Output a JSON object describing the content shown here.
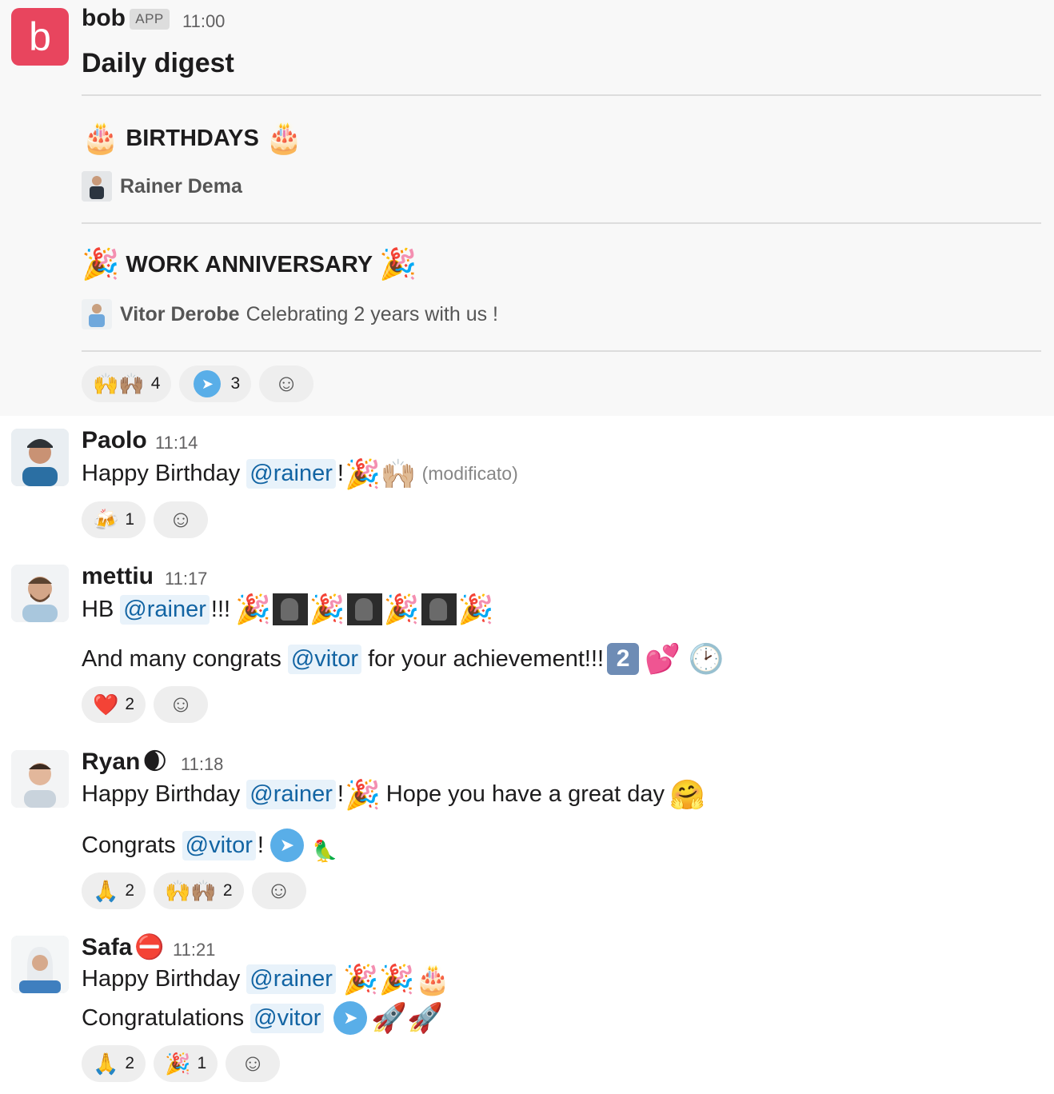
{
  "bot": {
    "name": "bob",
    "badge": "APP",
    "time": "11:00",
    "title": "Daily digest",
    "avatar_letter": "b",
    "birthdays_label": "BIRTHDAYS",
    "birthdays_emoji": "🎂",
    "birthday_person": "Rainer Dema",
    "anniversary_label": "WORK ANNIVERSARY",
    "anniversary_emoji": "🎉",
    "anniversary_person": "Vitor Derobe",
    "anniversary_note": "Celebrating 2 years with us !",
    "reactions": [
      {
        "emoji": "🙌🙌🏽",
        "count": "4"
      },
      {
        "emoji": "✈",
        "count": "3"
      }
    ]
  },
  "messages": {
    "paolo": {
      "name": "Paolo",
      "time": "11:14",
      "pre": "Happy Birthday",
      "mention": "@rainer",
      "post": "!",
      "emojis": "🎉🙌🏼",
      "edited": "(modificato)",
      "reaction_emoji": "🍻",
      "reaction_count": "1"
    },
    "mettiu": {
      "name": "mettiu",
      "time": "11:17",
      "line1_pre": "HB",
      "line1_mention": "@rainer",
      "line1_post": "!!!",
      "party": "🎉",
      "line2_pre": "And many congrats",
      "line2_mention": "@vitor",
      "line2_post": "for your achievement!!!",
      "keycap": "2",
      "line2_emojis": "💕 🕑",
      "reaction_emoji": "❤️",
      "reaction_count": "2"
    },
    "ryan": {
      "name": "Ryan",
      "status": "🌒",
      "time": "11:18",
      "line1_pre": "Happy Birthday",
      "line1_mention": "@rainer",
      "line1_post": "!",
      "line1_party": "🎉",
      "line1_text": "Hope you have a great day",
      "line1_hug": "🤗",
      "line2_pre": "Congrats",
      "line2_mention": "@vitor",
      "line2_post": "!",
      "line2_extra": "🦜",
      "reactions": [
        {
          "emoji": "🙏",
          "count": "2"
        },
        {
          "emoji": "🙌🙌🏽",
          "count": "2"
        }
      ]
    },
    "safa": {
      "name": "Safa",
      "status": "⛔",
      "time": "11:21",
      "line1_pre": "Happy Birthday",
      "line1_mention": "@rainer",
      "line1_emojis": "🎉🎉🎂",
      "line2_pre": "Congratulations",
      "line2_mention": "@vitor",
      "line2_emojis": "🚀🚀",
      "reactions": [
        {
          "emoji": "🙏",
          "count": "2"
        },
        {
          "emoji": "🎉",
          "count": "1"
        }
      ]
    }
  }
}
